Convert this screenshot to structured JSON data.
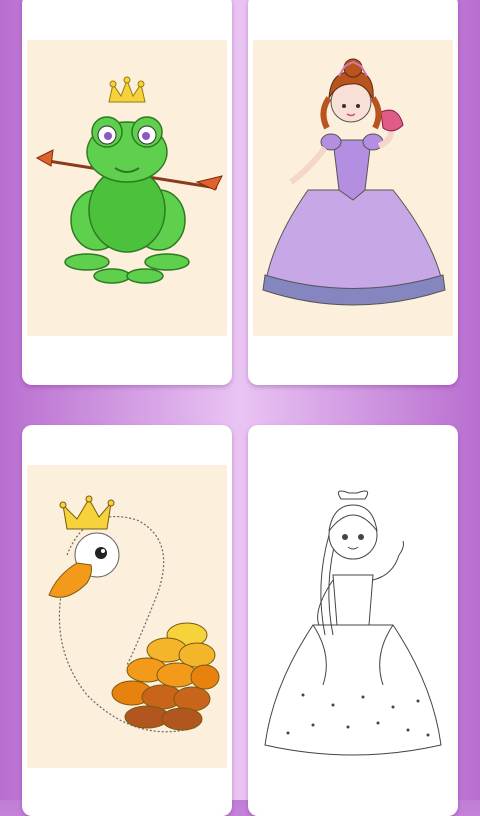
{
  "gallery": {
    "items": [
      {
        "subject": "frog-prince",
        "state": "colored",
        "canvas_color": "#fcefdc"
      },
      {
        "subject": "princess-purple-dress",
        "state": "colored",
        "canvas_color": "#fcefdc"
      },
      {
        "subject": "swan-with-crown",
        "state": "partially-colored",
        "canvas_color": "#fcefdc"
      },
      {
        "subject": "princess-outline",
        "state": "uncolored",
        "canvas_color": "#ffffff"
      }
    ]
  },
  "colors": {
    "accent": "#c27ed6",
    "frog_green": "#5fd04d",
    "crown_yellow": "#f6d23b",
    "dress_lilac": "#c7a7e6",
    "swan_orange": "#f39a1a"
  }
}
